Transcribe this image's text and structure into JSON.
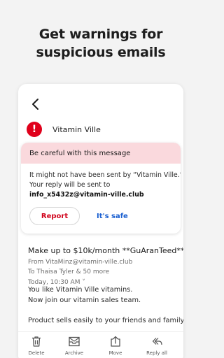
{
  "headline": {
    "line1": "Get warnings for",
    "line2": "suspicious emails"
  },
  "email": {
    "sender_name": "Vitamin Ville",
    "warning": {
      "title": "Be careful with this message",
      "line1": "It might not have been sent by “Vitamin Ville.”",
      "line2": "Your reply will be sent to",
      "address": "info_x5432z@vitamin-ville.club",
      "report_label": "Report",
      "safe_label": "It's safe"
    },
    "subject": "Make up to $10k/month **GuAranTeed**",
    "from": "From VitaMinz@vitamin-ville.club",
    "to": "To Thaisa Tyler & 50 more",
    "time": "Today, 10:30 AM ˅",
    "body": [
      "You like Vitamin Ville vitamins.",
      "Now join our vitamin sales team.",
      "Product sells easily to your friends and family."
    ]
  },
  "toolbar": {
    "delete": "Delete",
    "archive": "Archive",
    "move": "Move",
    "reply_all": "Reply all"
  },
  "colors": {
    "alert_red": "#e0001b",
    "warning_bg": "#fad9dd",
    "link_blue": "#1a5fd0",
    "report_red": "#d0021b"
  },
  "icons": [
    "back-arrow-icon",
    "alert-icon",
    "trash-icon",
    "archive-icon",
    "move-icon",
    "reply-all-icon"
  ]
}
